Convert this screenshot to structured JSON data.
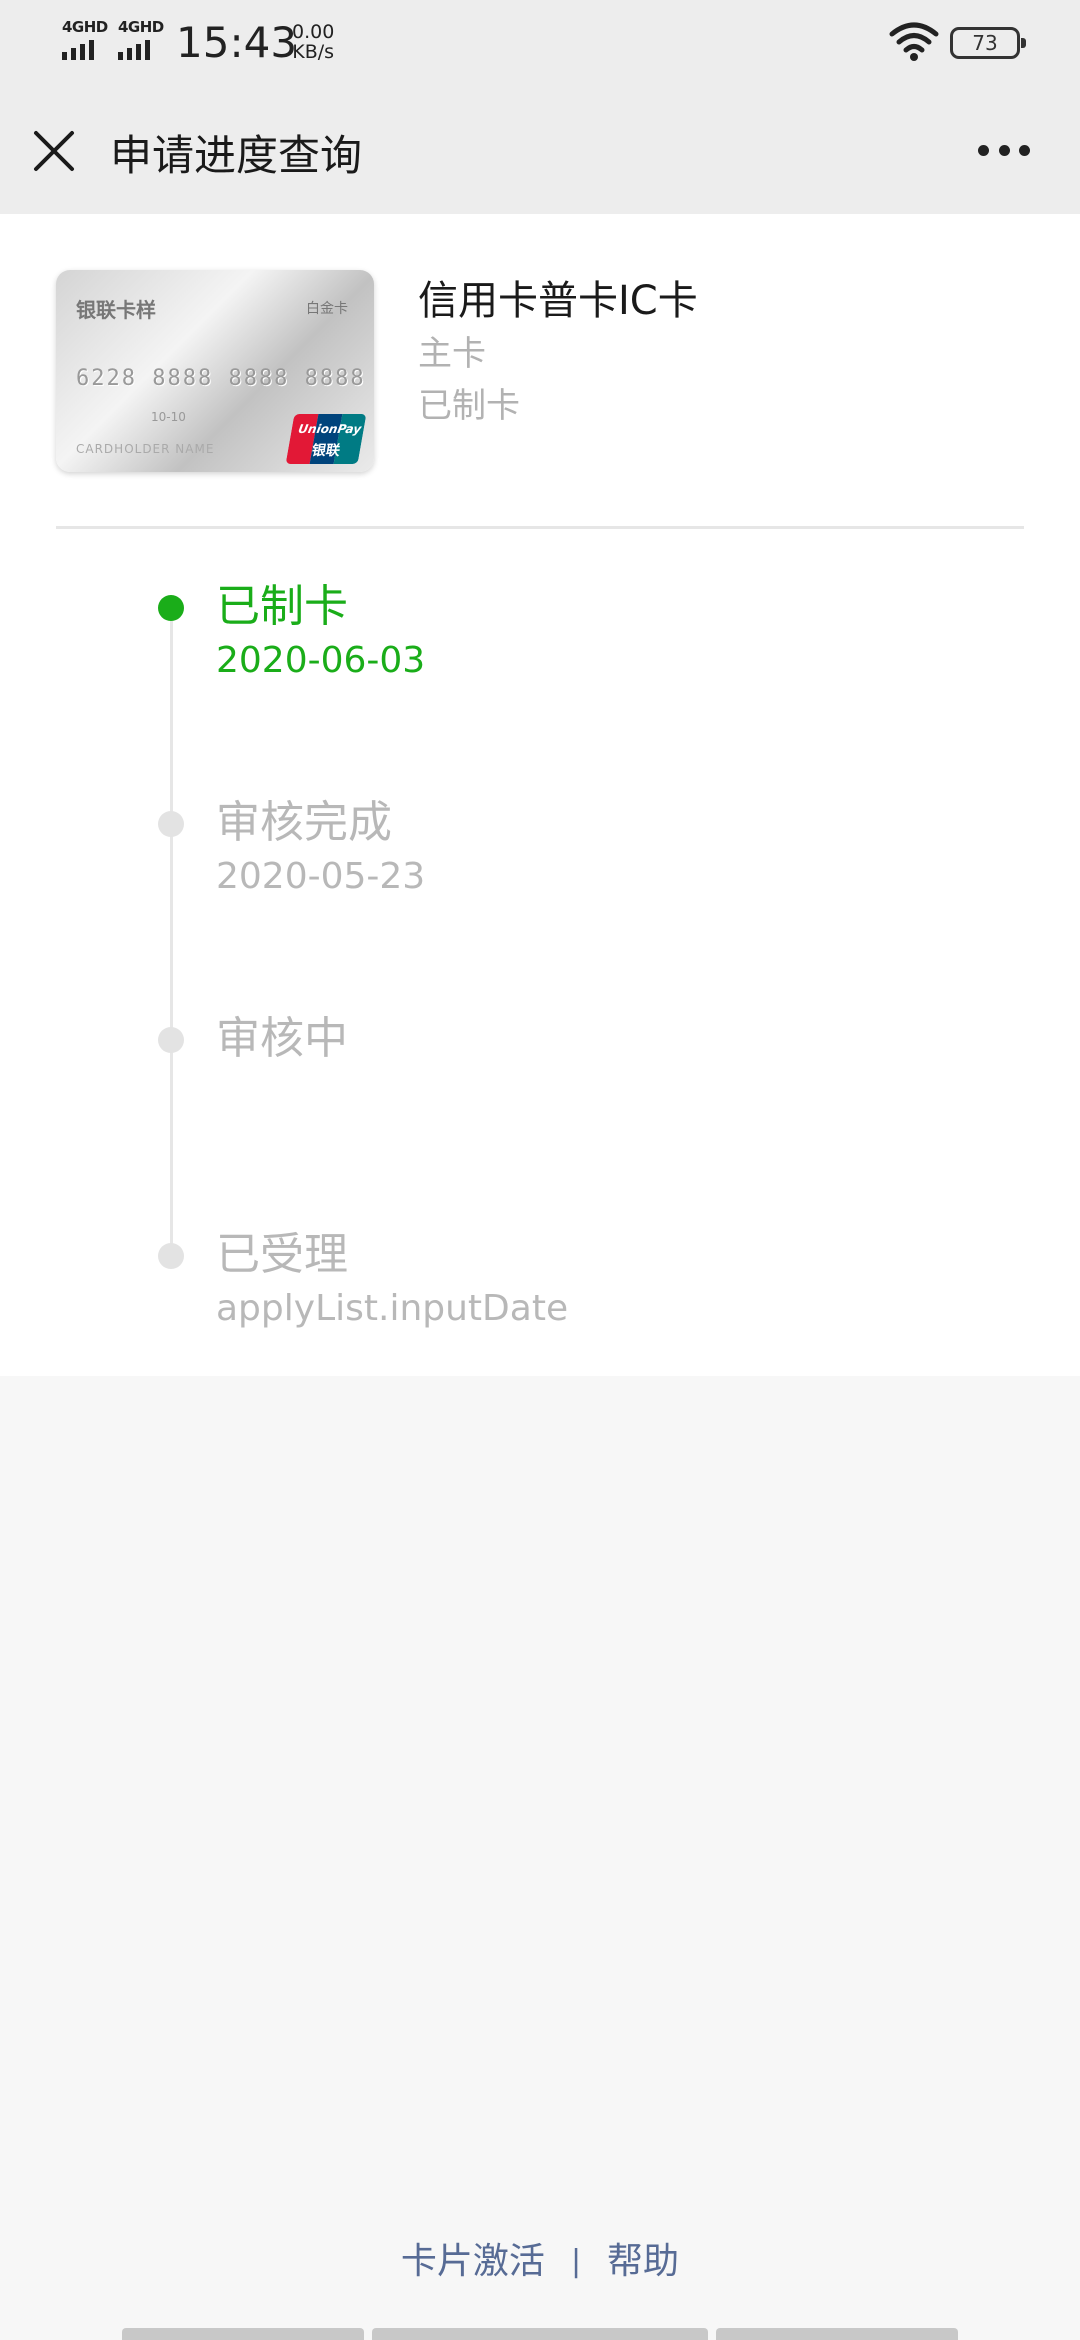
{
  "status_bar": {
    "network1": "4GHD",
    "network2": "4GHD",
    "time": "15:43",
    "speed_value": "0.00",
    "speed_unit": "KB/s",
    "battery": "73"
  },
  "nav": {
    "title": "申请进度查询",
    "close_icon": "close-icon",
    "more_icon": "more-icon"
  },
  "card": {
    "image_bank_name": "银联卡样",
    "image_card_type": "白金卡",
    "image_number": "6228 8888 8888 8888",
    "image_valid": "10-10",
    "image_holder": "CARDHOLDER NAME",
    "image_unionpay_en": "UnionPay",
    "image_unionpay_cn": "银联",
    "name": "信用卡普卡IC卡",
    "role": "主卡",
    "status": "已制卡"
  },
  "timeline": [
    {
      "title": "已制卡",
      "date": "2020-06-03",
      "active": true
    },
    {
      "title": "审核完成",
      "date": "2020-05-23",
      "active": false
    },
    {
      "title": "审核中",
      "date": "",
      "active": false
    },
    {
      "title": "已受理",
      "date": "applyList.inputDate",
      "active": false
    }
  ],
  "footer": {
    "activate_label": "卡片激活",
    "separator": "|",
    "help_label": "帮助"
  },
  "colors": {
    "accent_green": "#1aad19",
    "link_blue": "#576b95",
    "inactive_gray": "#b8b8b8"
  }
}
